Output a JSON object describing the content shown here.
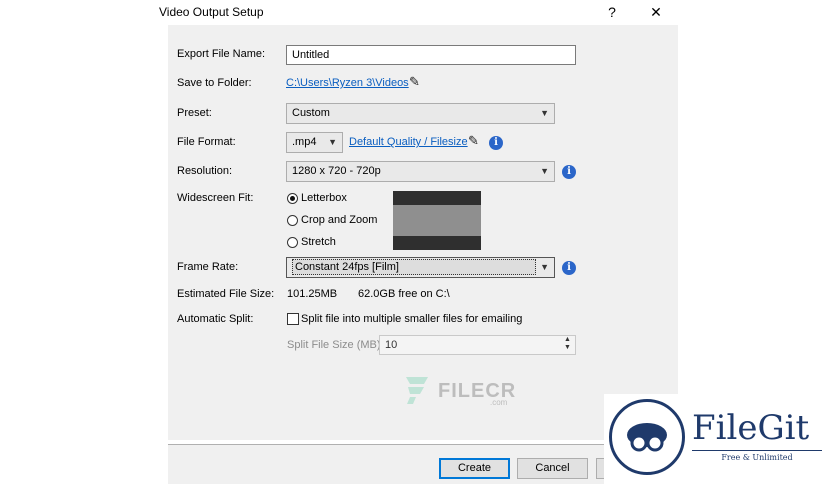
{
  "window": {
    "title": "Video Output Setup",
    "help_glyph": "?",
    "close_glyph": "✕"
  },
  "form": {
    "export_name_label": "Export File Name:",
    "export_name_value": "Untitled",
    "save_folder_label": "Save to Folder:",
    "save_folder_path": "C:\\Users\\Ryzen 3\\Videos",
    "preset_label": "Preset:",
    "preset_value": "Custom",
    "format_label": "File Format:",
    "format_value": ".mp4",
    "quality_link": "Default Quality / Filesize",
    "resolution_label": "Resolution:",
    "resolution_value": "1280 x 720 - 720p",
    "widescreen_label": "Widescreen Fit:",
    "widescreen_options": [
      "Letterbox",
      "Crop and Zoom",
      "Stretch"
    ],
    "widescreen_selected": "Letterbox",
    "framerate_label": "Frame Rate:",
    "framerate_value": "Constant 24fps [Film]",
    "filesize_label": "Estimated File Size:",
    "filesize_value": "101.25MB",
    "free_space": "62.0GB free on C:\\",
    "split_label": "Automatic Split:",
    "split_checkbox_label": "Split file into multiple smaller files for emailing",
    "split_checked": false,
    "split_size_label": "Split File Size (MB):",
    "split_size_value": "10"
  },
  "buttons": {
    "create": "Create",
    "cancel": "Cancel"
  },
  "watermarks": {
    "filecr_text": "FILECR",
    "filecr_sub": ".com",
    "filegit_title": "FileGit",
    "filegit_tagline": "Free & Unlimited"
  },
  "icons": {
    "pencil": "pencil-icon",
    "info": "info-icon",
    "dropdown": "chevron-down-icon",
    "spinner": "spinner-arrows-icon"
  },
  "colors": {
    "link": "#0a5ec0",
    "info": "#2b66c9",
    "default_button_border": "#0078d7"
  }
}
